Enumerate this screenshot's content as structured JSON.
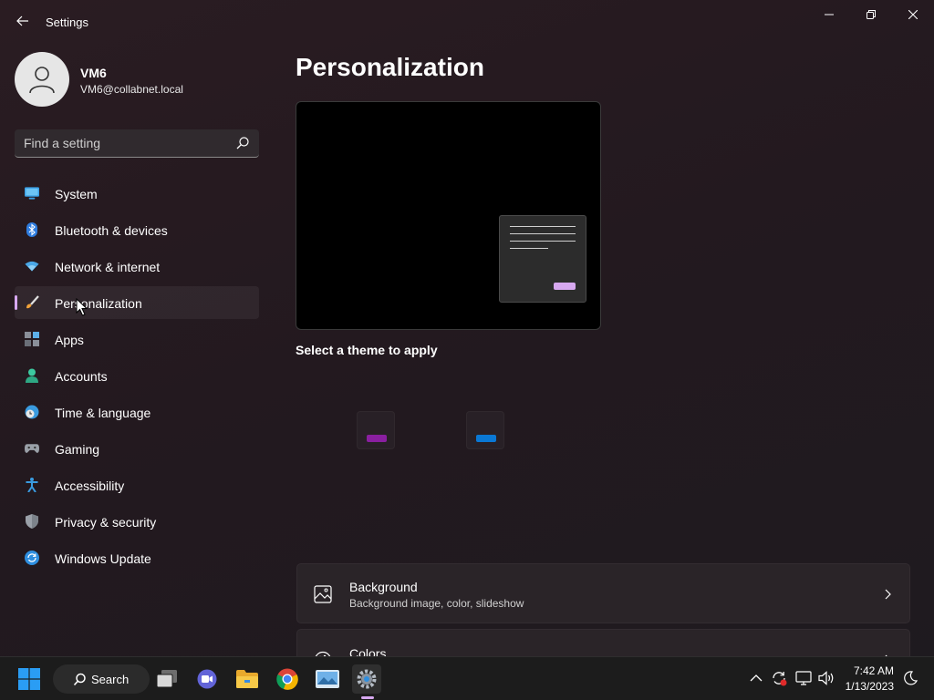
{
  "window": {
    "title": "Settings"
  },
  "profile": {
    "name": "VM6",
    "email": "VM6@collabnet.local"
  },
  "search": {
    "placeholder": "Find a setting"
  },
  "sidebar": {
    "items": [
      {
        "label": "System",
        "icon": "monitor-icon"
      },
      {
        "label": "Bluetooth & devices",
        "icon": "bluetooth-icon"
      },
      {
        "label": "Network & internet",
        "icon": "wifi-icon"
      },
      {
        "label": "Personalization",
        "icon": "paintbrush-icon",
        "selected": true
      },
      {
        "label": "Apps",
        "icon": "apps-icon"
      },
      {
        "label": "Accounts",
        "icon": "person-icon"
      },
      {
        "label": "Time & language",
        "icon": "globe-clock-icon"
      },
      {
        "label": "Gaming",
        "icon": "gamepad-icon"
      },
      {
        "label": "Accessibility",
        "icon": "accessibility-icon"
      },
      {
        "label": "Privacy & security",
        "icon": "shield-icon"
      },
      {
        "label": "Windows Update",
        "icon": "update-icon"
      }
    ]
  },
  "main": {
    "title": "Personalization",
    "theme_heading": "Select a theme to apply",
    "theme_tiles": [
      {
        "accent": "#8a1fa0"
      },
      {
        "accent": "#0a78d4"
      }
    ],
    "cards": [
      {
        "title": "Background",
        "subtitle": "Background image, color, slideshow",
        "icon": "image-icon"
      },
      {
        "title": "Colors",
        "subtitle": "",
        "icon": "palette-icon"
      }
    ]
  },
  "taskbar": {
    "search_label": "Search",
    "apps": [
      "start-icon",
      "task-view-icon",
      "teams-chat-icon",
      "file-explorer-icon",
      "chrome-icon",
      "photos-icon",
      "settings-icon"
    ],
    "clock": {
      "time": "7:42 AM",
      "date": "1/13/2023"
    }
  },
  "colors": {
    "accent": "#d7a8f0",
    "background": "#23191f",
    "taskbar": "#1c1c1c"
  }
}
